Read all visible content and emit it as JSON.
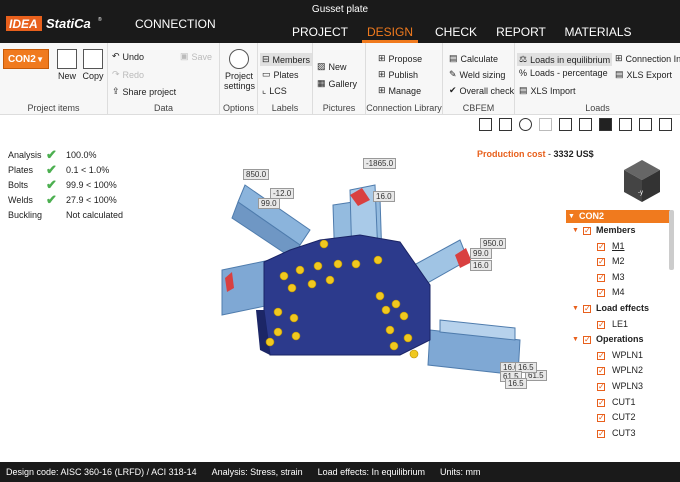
{
  "app": {
    "brand": "IDEA StatiCa",
    "product": "CONNECTION",
    "doc_title": "Gusset plate"
  },
  "menu": [
    "PROJECT",
    "DESIGN",
    "CHECK",
    "REPORT",
    "MATERIALS"
  ],
  "menu_active": "DESIGN",
  "ribbon": {
    "project": {
      "selected": "CON2",
      "new": "New",
      "copy": "Copy",
      "label": "Project items"
    },
    "data": {
      "undo": "Undo",
      "redo": "Redo",
      "save": "Save",
      "share": "Share project",
      "label": "Data"
    },
    "options": {
      "settings": "Project settings",
      "label": "Options"
    },
    "labels": {
      "members": "Members",
      "plates": "Plates",
      "lcs": "LCS",
      "label": "Labels"
    },
    "pictures": {
      "new": "New",
      "gallery": "Gallery",
      "label": "Pictures"
    },
    "library": {
      "propose": "Propose",
      "publish": "Publish",
      "manage": "Manage",
      "label": "Connection Library"
    },
    "cbfem": {
      "calculate": "Calculate",
      "weld": "Weld sizing",
      "overall": "Overall check",
      "label": "CBFEM"
    },
    "loads": {
      "eq": "Loads in equilibrium",
      "pct": "Loads - percentage",
      "xls_import": "XLS Import",
      "conn_in": "Connection In",
      "xls_export": "XLS Export",
      "label": "Loads"
    }
  },
  "results": [
    {
      "name": "Analysis",
      "value": "100.0%",
      "ok": true
    },
    {
      "name": "Plates",
      "value": "0.1 < 1.0%",
      "ok": true
    },
    {
      "name": "Bolts",
      "value": "99.9 < 100%",
      "ok": true
    },
    {
      "name": "Welds",
      "value": "27.9 < 100%",
      "ok": true
    },
    {
      "name": "Buckling",
      "value": "Not calculated",
      "ok": false
    }
  ],
  "cost": {
    "label": "Production cost",
    "sep": "-",
    "value": "3332 US$"
  },
  "tree": {
    "root": "CON2",
    "members_label": "Members",
    "members": [
      "M1",
      "M2",
      "M3",
      "M4"
    ],
    "loads_label": "Load effects",
    "loads": [
      "LE1"
    ],
    "ops_label": "Operations",
    "ops": [
      "WPLN1",
      "WPLN2",
      "WPLN3",
      "CUT1",
      "CUT2",
      "CUT3"
    ]
  },
  "dims": [
    "850.0",
    "-1865.0",
    "950.0",
    "-12.0",
    "99.0",
    "16.0",
    "99.0",
    "16.0",
    "16.0",
    "61.5",
    "16.5",
    "61.5",
    "16.5"
  ],
  "status": {
    "code": "Design code: AISC 360-16 (LRFD) / ACI 318-14",
    "analysis": "Analysis: Stress, strain",
    "effects": "Load effects: In equilibrium",
    "units": "Units: mm"
  }
}
